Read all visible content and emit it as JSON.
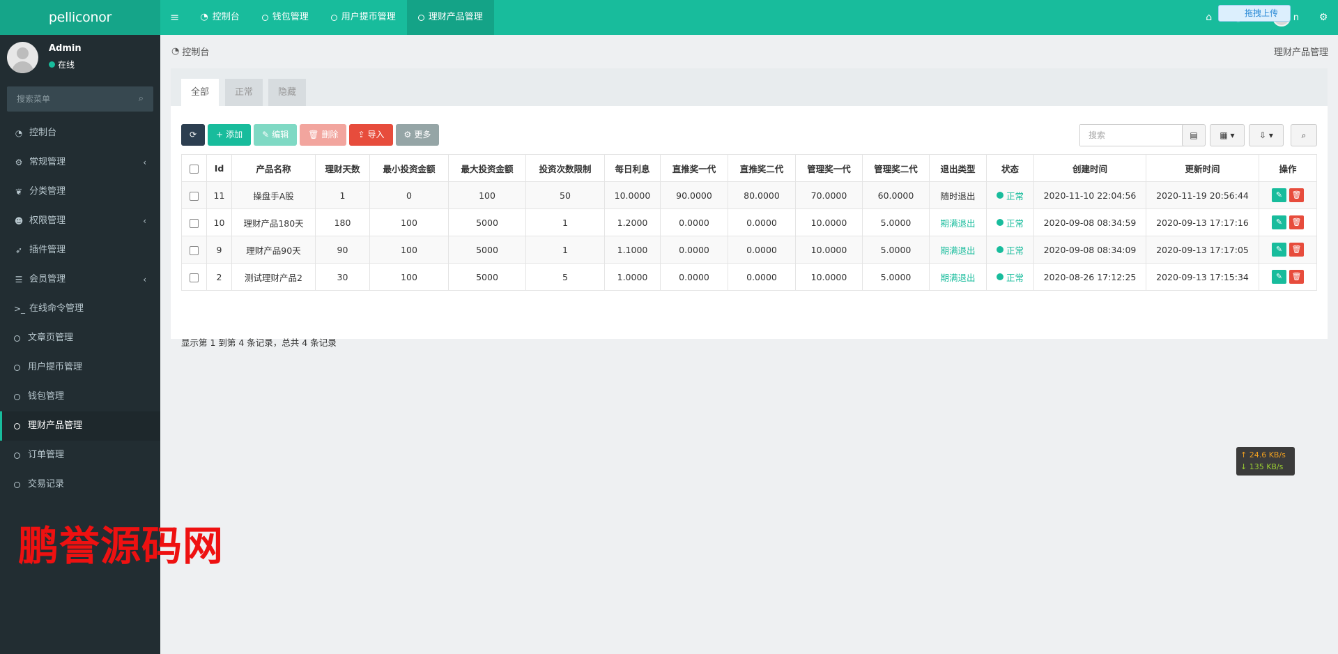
{
  "app": {
    "logo": "pelliconor"
  },
  "topnav": {
    "tabs": [
      {
        "label": "控制台"
      },
      {
        "label": "钱包管理"
      },
      {
        "label": "用户提币管理"
      },
      {
        "label": "理财产品管理"
      }
    ],
    "upload_label": "拖拽上传",
    "user_label": "n"
  },
  "user": {
    "name": "Admin",
    "status": "在线"
  },
  "sidebar": {
    "search_placeholder": "搜索菜单",
    "items": [
      {
        "label": "控制台",
        "icon": "dashboard-icon"
      },
      {
        "label": "常规管理",
        "icon": "cogs-icon",
        "chevron": true
      },
      {
        "label": "分类管理",
        "icon": "leaf-icon"
      },
      {
        "label": "权限管理",
        "icon": "group-icon",
        "chevron": true
      },
      {
        "label": "插件管理",
        "icon": "rocket-icon"
      },
      {
        "label": "会员管理",
        "icon": "list-icon",
        "chevron": true
      },
      {
        "label": "在线命令管理",
        "icon": "terminal-icon"
      },
      {
        "label": "文章页管理",
        "icon": "circle-icon"
      },
      {
        "label": "用户提币管理",
        "icon": "circle-icon"
      },
      {
        "label": "钱包管理",
        "icon": "circle-icon"
      },
      {
        "label": "理财产品管理",
        "icon": "circle-icon",
        "active": true
      },
      {
        "label": "订单管理",
        "icon": "circle-icon"
      },
      {
        "label": "交易记录",
        "icon": "circle-icon"
      }
    ]
  },
  "watermark": "鹏誉源码网",
  "breadcrumb": {
    "label": "控制台",
    "page_title": "理财产品管理"
  },
  "panel": {
    "tabs": [
      "全部",
      "正常",
      "隐藏"
    ],
    "toolbar": {
      "add": "添加",
      "edit": "编辑",
      "delete": "删除",
      "import": "导入",
      "more": "更多"
    },
    "search_placeholder": "搜索"
  },
  "table": {
    "columns": [
      "Id",
      "产品名称",
      "理财天数",
      "最小投资金额",
      "最大投资金额",
      "投资次数限制",
      "每日利息",
      "直推奖一代",
      "直推奖二代",
      "管理奖一代",
      "管理奖二代",
      "退出类型",
      "状态",
      "创建时间",
      "更新时间",
      "操作"
    ],
    "rows": [
      [
        "11",
        "操盘手A股",
        "1",
        "0",
        "100",
        "50",
        "10.0000",
        "90.0000",
        "80.0000",
        "70.0000",
        "60.0000",
        "随时退出",
        "正常",
        "2020-11-10 22:04:56",
        "2020-11-19 20:56:44"
      ],
      [
        "10",
        "理财产品180天",
        "180",
        "100",
        "5000",
        "1",
        "1.2000",
        "0.0000",
        "0.0000",
        "10.0000",
        "5.0000",
        "期满退出",
        "正常",
        "2020-09-08 08:34:59",
        "2020-09-13 17:17:16"
      ],
      [
        "9",
        "理财产品90天",
        "90",
        "100",
        "5000",
        "1",
        "1.1000",
        "0.0000",
        "0.0000",
        "10.0000",
        "5.0000",
        "期满退出",
        "正常",
        "2020-09-08 08:34:09",
        "2020-09-13 17:17:05"
      ],
      [
        "2",
        "测试理财产品2",
        "30",
        "100",
        "5000",
        "5",
        "1.0000",
        "0.0000",
        "0.0000",
        "10.0000",
        "5.0000",
        "期满退出",
        "正常",
        "2020-08-26 17:12:25",
        "2020-09-13 17:15:34"
      ]
    ],
    "summary": "显示第 1 到第 4 条记录，总共 4 条记录"
  },
  "speed": {
    "up": "↑ 24.6 KB/s",
    "down": "↓ 135 KB/s"
  },
  "colors": {
    "primary": "#18bc9c",
    "sidebar": "#222d32",
    "danger": "#e74c3c",
    "dark": "#2c3e50",
    "watermark": "#ee1111"
  }
}
